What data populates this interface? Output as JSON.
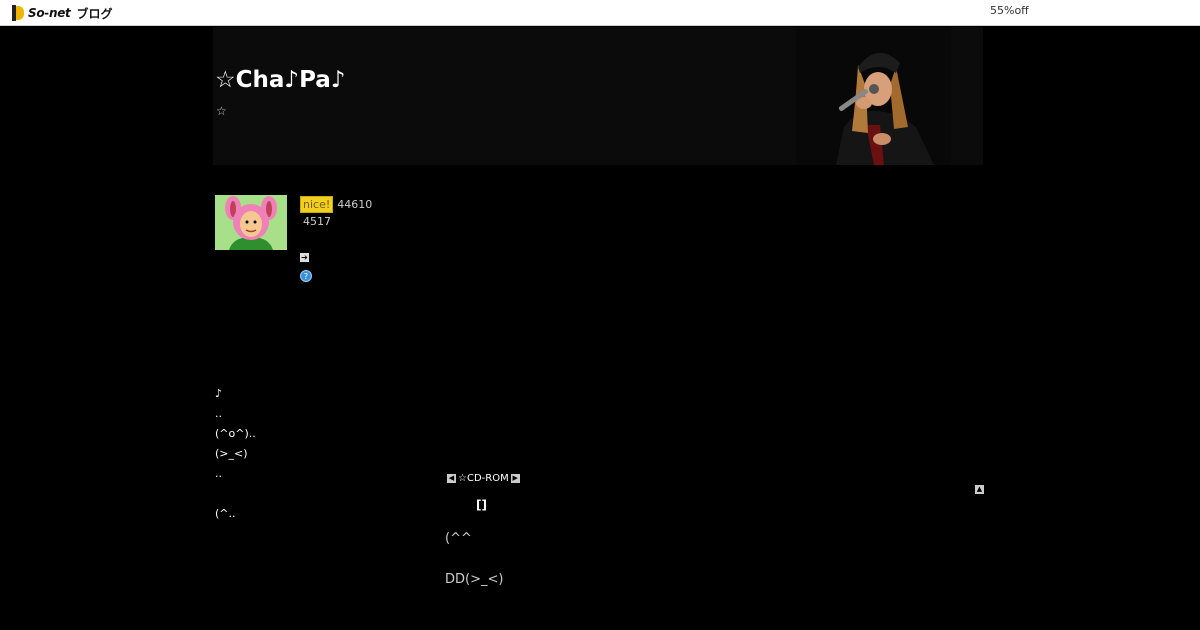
{
  "topbar": {
    "brand": "So-net",
    "service": "ブログ",
    "promo": "55%off"
  },
  "header": {
    "title": "☆Cha♪Pa♪",
    "description": "☆"
  },
  "profile": {
    "nice_label": "nice!",
    "nice_count": "44610",
    "second_count": "4517",
    "arrow_glyph": "➔",
    "help_glyph": "?"
  },
  "sidebar": {
    "lines": [
      "♪",
      "..",
      "(^o^)..",
      "(>_<)",
      "..",
      "",
      " (^.."
    ]
  },
  "article": {
    "nav_label": "☆CD-ROM",
    "category": "[]",
    "body_line1": "(^^",
    "body_line2": "DD(>_<)"
  }
}
